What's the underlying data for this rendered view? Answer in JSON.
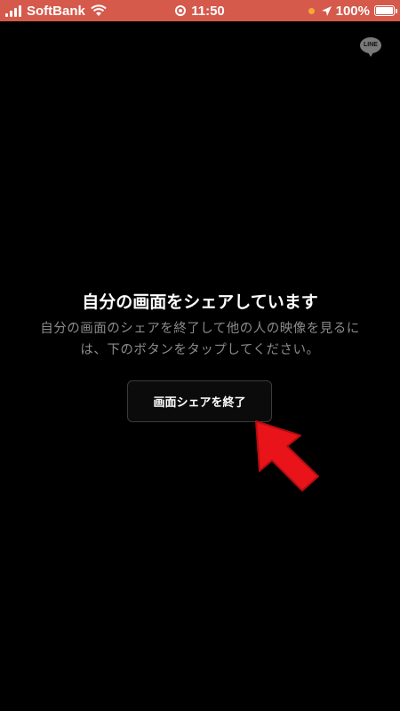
{
  "status_bar": {
    "carrier": "SoftBank",
    "time": "11:50",
    "battery": "100%"
  },
  "badge": {
    "label": "LINE"
  },
  "main": {
    "title": "自分の画面をシェアしています",
    "description": "自分の画面のシェアを終了して他の人の映像を見るには、下のボタンをタップしてください。",
    "button_label": "画面シェアを終了"
  },
  "colors": {
    "status_bar": "#d55a4c",
    "background": "#000000",
    "arrow": "#e8141a"
  }
}
